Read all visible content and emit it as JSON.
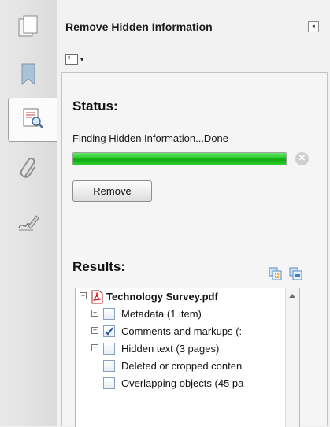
{
  "panel": {
    "title": "Remove Hidden Information",
    "collapse_glyph": "◂"
  },
  "rail": {
    "items": [
      {
        "icon": "page-thumbnails-icon",
        "active": false
      },
      {
        "icon": "bookmark-icon",
        "active": false
      },
      {
        "icon": "document-search-icon",
        "active": true
      },
      {
        "icon": "paperclip-icon",
        "active": false
      },
      {
        "icon": "signature-pen-icon",
        "active": false
      }
    ]
  },
  "toolbar": {
    "options_icon": "list-options-icon",
    "caret": "▾"
  },
  "status": {
    "heading": "Status:",
    "message": "Finding Hidden Information...Done",
    "progress": 1.0,
    "progress_color": "#22c722",
    "cancel_glyph": "✕",
    "remove_label": "Remove"
  },
  "results": {
    "heading": "Results:",
    "expand_all_icon": "expand-all-icon",
    "collapse_all_icon": "collapse-all-icon",
    "tree": {
      "root": {
        "label": "Technology Survey.pdf",
        "icon": "pdf-file-icon",
        "expander": "−"
      },
      "items": [
        {
          "label": "Metadata (1 item)",
          "checked": false,
          "expander": "+"
        },
        {
          "label": "Comments and markups (:",
          "checked": true,
          "expander": "+"
        },
        {
          "label": "Hidden text (3 pages)",
          "checked": false,
          "expander": "+"
        },
        {
          "label": "Deleted or cropped conten",
          "checked": false,
          "expander": ""
        },
        {
          "label": "Overlapping objects (45 pa",
          "checked": false,
          "expander": ""
        }
      ]
    }
  }
}
